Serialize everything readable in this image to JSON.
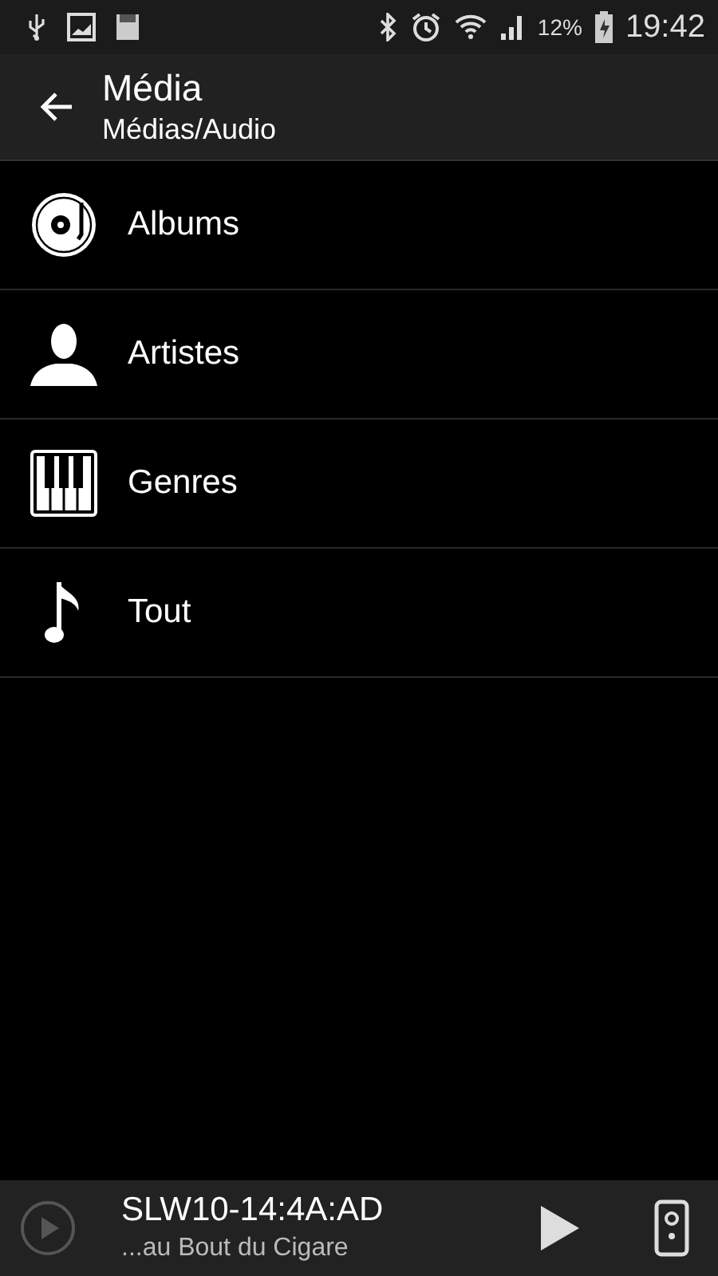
{
  "status_bar": {
    "battery": "12%",
    "time": "19:42"
  },
  "header": {
    "title": "Média",
    "subtitle": "Médias/Audio"
  },
  "items": [
    {
      "kind": "album",
      "label": "Albums"
    },
    {
      "kind": "artist",
      "label": "Artistes"
    },
    {
      "kind": "genre",
      "label": "Genres"
    },
    {
      "kind": "all",
      "label": "Tout"
    }
  ],
  "player": {
    "device": "SLW10-14:4A:AD",
    "track": "...au Bout du Cigare"
  }
}
